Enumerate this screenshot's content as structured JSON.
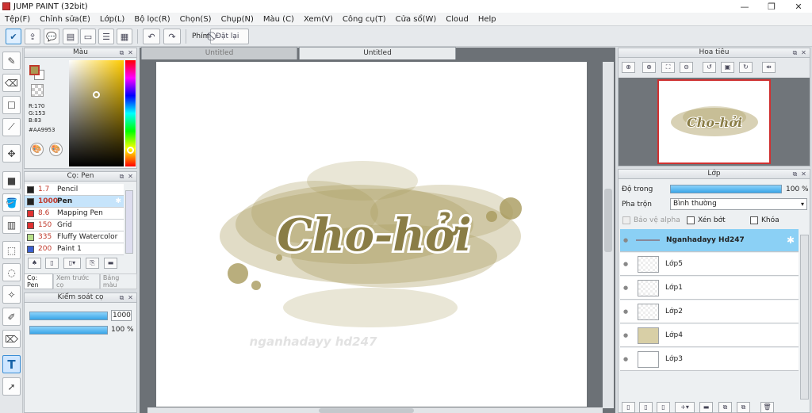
{
  "window": {
    "title": "JUMP PAINT (32bit)",
    "minimize": "—",
    "restore": "❐",
    "close": "✕"
  },
  "menu": [
    "Tệp(F)",
    "Chỉnh sửa(E)",
    "Lớp(L)",
    "Bộ lọc(R)",
    "Chọn(S)",
    "Chụp(N)",
    "Màu (C)",
    "Xem(V)",
    "Công cụ(T)",
    "Cửa sổ(W)",
    "Cloud",
    "Help"
  ],
  "toolbar": {
    "phim_label": "Phím",
    "reset_label": "Đặt lại"
  },
  "tabs": [
    "Untitled",
    "Untitled"
  ],
  "color_panel": {
    "title": "Màu",
    "r": "R:170",
    "g": "G:153",
    "b": "B:83",
    "hex": "#AA9953",
    "main_color": "#aa9953"
  },
  "brush_panel": {
    "title": "Cọ: Pen",
    "brushes": [
      {
        "size": "1.7",
        "name": "Pencil",
        "color": "#222222"
      },
      {
        "size": "1000",
        "name": "Pen",
        "color": "#222222"
      },
      {
        "size": "8.6",
        "name": "Mapping Pen",
        "color": "#e03030"
      },
      {
        "size": "150",
        "name": "Grid",
        "color": "#e03030"
      },
      {
        "size": "335",
        "name": "Fluffy Watercolor",
        "color": "#b8e08a"
      },
      {
        "size": "200",
        "name": "Paint 1",
        "color": "#3a5fd0"
      }
    ],
    "tabs": [
      "Cọ: Pen",
      "Xem trước cọ",
      "Bảng màu"
    ]
  },
  "brush_control": {
    "title": "Kiểm soát cọ",
    "size": "1000",
    "opacity": "100 %"
  },
  "canvas": {
    "art_text": "Cho-hởi",
    "watermark": "nganhadayy hd247",
    "ink_color": "#a89a5c"
  },
  "navigator": {
    "title": "Hoa tiêu"
  },
  "layer_panel": {
    "title": "Lớp",
    "opacity_label": "Độ trong",
    "opacity_value": "100 %",
    "blend_label": "Pha trộn",
    "blend_value": "Bình thường",
    "protect_alpha": "Bảo vệ alpha",
    "clip": "Xén bớt",
    "lock": "Khóa",
    "layers": [
      "Nganhadayy Hd247",
      "Lớp5",
      "Lớp1",
      "Lớp2",
      "Lớp4",
      "Lớp3"
    ]
  }
}
